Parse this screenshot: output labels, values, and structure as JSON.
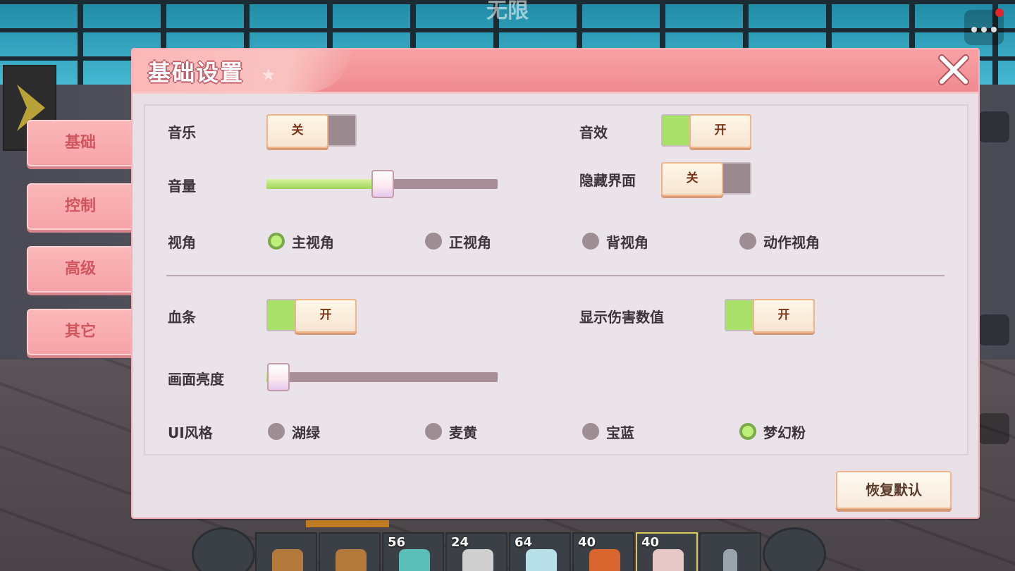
{
  "game": {
    "world_title": "无限",
    "hotbar": {
      "slots": [
        {
          "count": ""
        },
        {
          "count": ""
        },
        {
          "count": "56"
        },
        {
          "count": "24"
        },
        {
          "count": "64"
        },
        {
          "count": "40"
        },
        {
          "count": "40"
        },
        {
          "count": ""
        }
      ]
    }
  },
  "dialog": {
    "title": "基础设置",
    "close_icon": "close-x-icon"
  },
  "tabs": [
    {
      "label": "基础"
    },
    {
      "label": "控制"
    },
    {
      "label": "高级"
    },
    {
      "label": "其它"
    }
  ],
  "settings": {
    "music": {
      "label": "音乐",
      "state": "关"
    },
    "sound_effects": {
      "label": "音效",
      "state": "开"
    },
    "volume": {
      "label": "音量",
      "value": 0.5
    },
    "hide_ui": {
      "label": "隐藏界面",
      "state": "关"
    },
    "view": {
      "label": "视角",
      "options": [
        "主视角",
        "正视角",
        "背视角",
        "动作视角"
      ],
      "selected": "主视角"
    },
    "health_bar": {
      "label": "血条",
      "state": "开"
    },
    "show_damage": {
      "label": "显示伤害数值",
      "state": "开"
    },
    "brightness": {
      "label": "画面亮度",
      "value": 0.05
    },
    "ui_style": {
      "label": "UI风格",
      "options": [
        "湖绿",
        "麦黄",
        "宝蓝",
        "梦幻粉"
      ],
      "selected": "梦幻粉"
    }
  },
  "reset_button": {
    "label": "恢复默认"
  },
  "colors": {
    "accent_pink": "#f08a90",
    "toggle_on": "#a8e06a",
    "toggle_off": "#9a8a90"
  }
}
